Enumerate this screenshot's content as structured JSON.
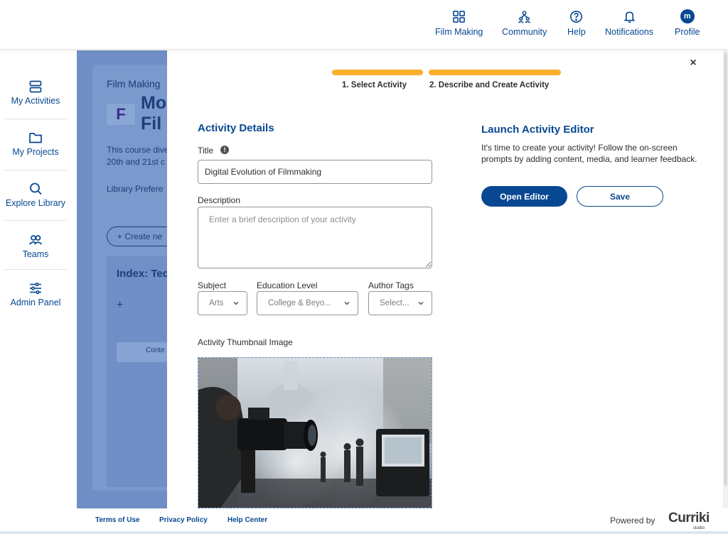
{
  "header": {
    "nav": [
      {
        "label": "Film Making",
        "icon": "grid-icon"
      },
      {
        "label": "Community",
        "icon": "community-icon"
      },
      {
        "label": "Help",
        "icon": "help-icon"
      },
      {
        "label": "Notifications",
        "icon": "bell-icon"
      },
      {
        "label": "Profile",
        "icon": "avatar",
        "initial": "m"
      }
    ]
  },
  "sidebar": {
    "items": [
      {
        "label": "My Activities",
        "icon": "activities-icon"
      },
      {
        "label": "My Projects",
        "icon": "folder-icon"
      },
      {
        "label": "Explore Library",
        "icon": "search-icon"
      },
      {
        "label": "Teams",
        "icon": "teams-icon"
      },
      {
        "label": "Admin Panel",
        "icon": "sliders-icon"
      }
    ]
  },
  "background_page": {
    "breadcrumb": "Film Making",
    "title_line1": "Mo",
    "title_line2": "Fil",
    "description_line1": "This course dive",
    "description_line2": "20th and 21st c",
    "library_link": "Library Prefere",
    "create_button": "+  Create ne",
    "index_title": "Index: Tec",
    "row_label": "Conte"
  },
  "modal": {
    "steps": [
      {
        "label": "1. Select Activity"
      },
      {
        "label": "2. Describe and Create Activity"
      }
    ],
    "details": {
      "heading": "Activity Details",
      "title_label": "Title",
      "title_value": "Digital Evolution of Filmmaking",
      "description_label": "Description",
      "description_placeholder": "Enter a brief description of your activity",
      "subject_label": "Subject",
      "subject_value": "Arts",
      "education_label": "Education Level",
      "education_value": "College & Beyo...",
      "tags_label": "Author Tags",
      "tags_value": "Select...",
      "thumbnail_label": "Activity Thumbnail Image"
    },
    "launch": {
      "heading": "Launch Activity Editor",
      "text": "It's time to create your activity! Follow the on-screen prompts by adding content, media, and learner feedback.",
      "open_editor": "Open Editor",
      "save": "Save"
    }
  },
  "footer": {
    "terms": "Terms of Use",
    "privacy": "Privacy Policy",
    "help_center": "Help Center",
    "powered_by": "Powered by",
    "brand": "Curriki",
    "brand_sub": "studio"
  },
  "colors": {
    "primary": "#084892",
    "accent": "#f8af2c",
    "overlay": "#6f8fc6"
  }
}
